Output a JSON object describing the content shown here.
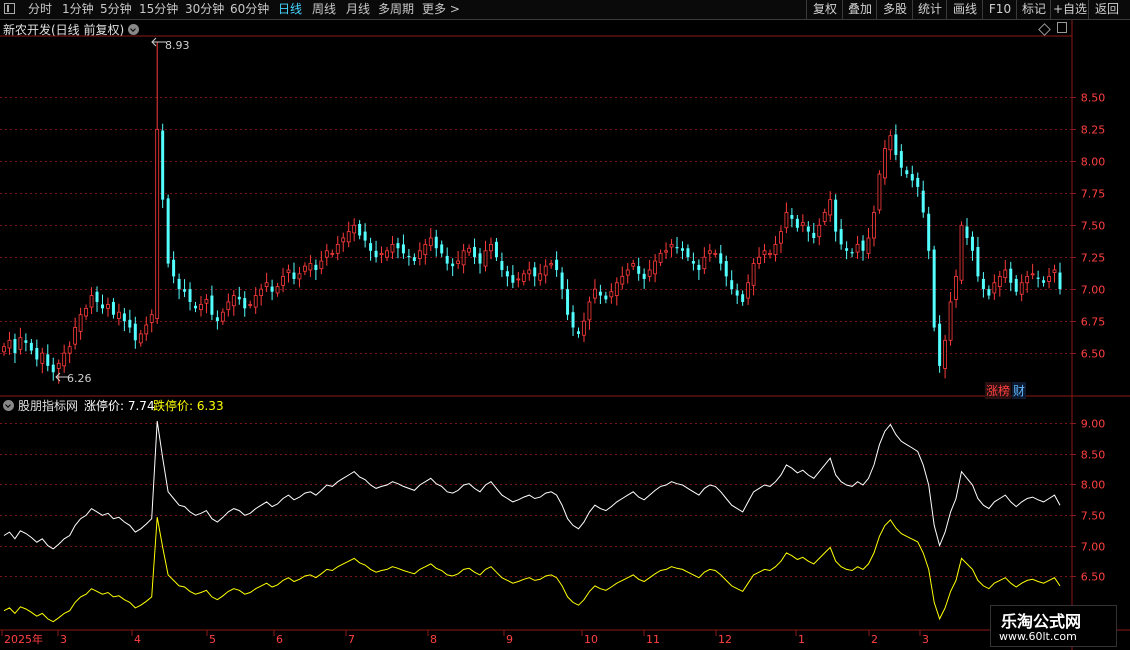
{
  "toolbar": {
    "periods": [
      "分时",
      "1分钟",
      "5分钟",
      "15分钟",
      "30分钟",
      "60分钟",
      "日线",
      "周线",
      "月线",
      "多周期",
      "更多 >"
    ],
    "active_period": "日线",
    "right_buttons": [
      "复权",
      "叠加",
      "多股",
      "统计",
      "画线",
      "F10",
      "标记",
      "+自选",
      "返回"
    ]
  },
  "main_chart": {
    "title": "新农开发(日线 前复权)",
    "high_label": "8.93",
    "low_label": "6.26",
    "tags": [
      "涨榜",
      "财"
    ],
    "up_color": "#ff3b3b",
    "down_color": "#54ffff"
  },
  "indicator": {
    "name": "股朋指标网",
    "label1": "涨停价: 7.74",
    "label2": "跌停价: 6.33",
    "line1_color": "#ffffff",
    "line2_color": "#ffff00"
  },
  "watermark": {
    "line1": "乐淘公式网",
    "line2": "www.60lt.com"
  },
  "chart_data": [
    {
      "type": "candlestick",
      "title": "新农开发(日线 前复权)",
      "y_ticks": [
        6.5,
        6.75,
        7.0,
        7.25,
        7.5,
        7.75,
        8.0,
        8.25,
        8.5
      ],
      "ylim": [
        6.18,
        8.98
      ],
      "annotations": [
        {
          "text": "8.93",
          "value": 8.93
        },
        {
          "text": "6.26",
          "value": 6.26
        }
      ],
      "closes": [
        6.55,
        6.6,
        6.5,
        6.62,
        6.58,
        6.52,
        6.45,
        6.5,
        6.4,
        6.35,
        6.42,
        6.5,
        6.55,
        6.7,
        6.8,
        6.85,
        6.95,
        6.9,
        6.85,
        6.88,
        6.8,
        6.82,
        6.75,
        6.7,
        6.6,
        6.65,
        6.72,
        6.8,
        8.25,
        7.7,
        7.2,
        7.1,
        7.0,
        6.98,
        6.9,
        6.85,
        6.88,
        6.92,
        6.8,
        6.75,
        6.82,
        6.9,
        6.95,
        6.92,
        6.85,
        6.88,
        6.95,
        7.0,
        7.05,
        6.98,
        7.02,
        7.1,
        7.15,
        7.08,
        7.12,
        7.18,
        7.2,
        7.15,
        7.22,
        7.3,
        7.28,
        7.35,
        7.4,
        7.45,
        7.5,
        7.42,
        7.38,
        7.3,
        7.25,
        7.28,
        7.3,
        7.35,
        7.32,
        7.28,
        7.25,
        7.22,
        7.3,
        7.35,
        7.4,
        7.32,
        7.28,
        7.2,
        7.18,
        7.22,
        7.3,
        7.32,
        7.25,
        7.2,
        7.3,
        7.35,
        7.25,
        7.15,
        7.1,
        7.05,
        7.08,
        7.12,
        7.15,
        7.1,
        7.12,
        7.18,
        7.2,
        7.15,
        7.0,
        6.8,
        6.7,
        6.65,
        6.75,
        6.9,
        7.0,
        6.95,
        6.92,
        6.98,
        7.05,
        7.1,
        7.15,
        7.2,
        7.12,
        7.08,
        7.15,
        7.22,
        7.28,
        7.3,
        7.35,
        7.32,
        7.3,
        7.25,
        7.2,
        7.15,
        7.25,
        7.3,
        7.28,
        7.2,
        7.1,
        7.0,
        6.95,
        6.9,
        7.05,
        7.2,
        7.25,
        7.3,
        7.28,
        7.35,
        7.45,
        7.6,
        7.55,
        7.48,
        7.52,
        7.45,
        7.4,
        7.5,
        7.6,
        7.7,
        7.45,
        7.35,
        7.3,
        7.28,
        7.35,
        7.3,
        7.4,
        7.6,
        7.9,
        8.1,
        8.2,
        8.05,
        7.95,
        7.9,
        7.85,
        7.8,
        7.6,
        7.3,
        6.7,
        6.4,
        6.6,
        6.9,
        7.1,
        7.5,
        7.4,
        7.3,
        7.1,
        7.0,
        6.95,
        7.05,
        7.1,
        7.15,
        7.05,
        6.98,
        7.05,
        7.1,
        7.12,
        7.08,
        7.05,
        7.1,
        7.15,
        7.0
      ]
    },
    {
      "type": "line",
      "series": [
        {
          "name": "涨停价",
          "last_value": 7.74
        },
        {
          "name": "跌停价",
          "last_value": 6.33
        }
      ],
      "y_ticks": [
        6.5,
        7.0,
        7.5,
        8.0,
        8.5,
        9.0
      ],
      "ylim": [
        5.75,
        9.25
      ]
    }
  ],
  "x_axis": {
    "ticks": [
      "2025年",
      "3",
      "4",
      "5",
      "6",
      "7",
      "8",
      "9",
      "10",
      "11",
      "12",
      "1",
      "2",
      "3"
    ]
  },
  "icons": [
    "menu-toggle-icon",
    "collapse-circle-icon",
    "diamond-icon",
    "window-icon"
  ]
}
